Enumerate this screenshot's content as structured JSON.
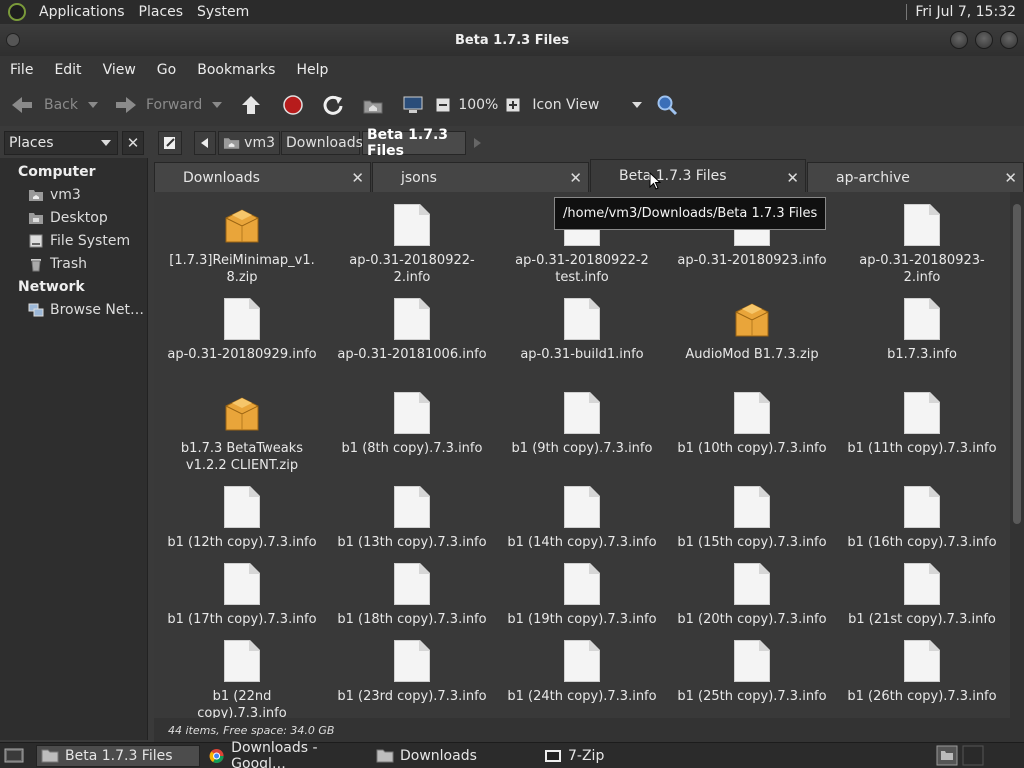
{
  "top_panel": {
    "menus": [
      "Applications",
      "Places",
      "System"
    ],
    "clock": "Fri Jul  7, 15:32"
  },
  "window": {
    "title": "Beta 1.7.3 Files"
  },
  "menubar": [
    "File",
    "Edit",
    "View",
    "Go",
    "Bookmarks",
    "Help"
  ],
  "toolbar": {
    "back": "Back",
    "forward": "Forward",
    "zoom": "100%",
    "view_mode": "Icon View"
  },
  "location": {
    "places_label": "Places",
    "close_glyph": "✕",
    "crumbs": [
      "vm3",
      "Downloads",
      "Beta 1.7.3 Files"
    ]
  },
  "sidebar": {
    "computer_label": "Computer",
    "computer_items": [
      "vm3",
      "Desktop",
      "File System",
      "Trash"
    ],
    "network_label": "Network",
    "network_items": [
      "Browse Net…"
    ]
  },
  "tabs": [
    "Downloads",
    "jsons",
    "Beta 1.7.3 Files",
    "ap-archive"
  ],
  "tab_close_glyph": "✕",
  "tooltip": "/home/vm3/Downloads/Beta 1.7.3 Files",
  "files": [
    {
      "name": "[1.7.3]ReiMinimap_v1.8.zip",
      "kind": "zip"
    },
    {
      "name": "ap-0.31-20180922-2.info",
      "kind": "doc"
    },
    {
      "name": "ap-0.31-20180922-2 test.info",
      "kind": "doc"
    },
    {
      "name": "ap-0.31-20180923.info",
      "kind": "doc"
    },
    {
      "name": "ap-0.31-20180923-2.info",
      "kind": "doc"
    },
    {
      "name": "ap-0.31-20180929.info",
      "kind": "doc"
    },
    {
      "name": "ap-0.31-20181006.info",
      "kind": "doc"
    },
    {
      "name": "ap-0.31-build1.info",
      "kind": "doc"
    },
    {
      "name": "AudioMod B1.7.3.zip",
      "kind": "zip"
    },
    {
      "name": "b1.7.3.info",
      "kind": "doc"
    },
    {
      "name": "b1.7.3 BetaTweaks v1.2.2 CLIENT.zip",
      "kind": "zip"
    },
    {
      "name": "b1 (8th copy).7.3.info",
      "kind": "doc"
    },
    {
      "name": "b1 (9th copy).7.3.info",
      "kind": "doc"
    },
    {
      "name": "b1 (10th copy).7.3.info",
      "kind": "doc"
    },
    {
      "name": "b1 (11th copy).7.3.info",
      "kind": "doc"
    },
    {
      "name": "b1 (12th copy).7.3.info",
      "kind": "doc"
    },
    {
      "name": "b1 (13th copy).7.3.info",
      "kind": "doc"
    },
    {
      "name": "b1 (14th copy).7.3.info",
      "kind": "doc"
    },
    {
      "name": "b1 (15th copy).7.3.info",
      "kind": "doc"
    },
    {
      "name": "b1 (16th copy).7.3.info",
      "kind": "doc"
    },
    {
      "name": "b1 (17th copy).7.3.info",
      "kind": "doc"
    },
    {
      "name": "b1 (18th copy).7.3.info",
      "kind": "doc"
    },
    {
      "name": "b1 (19th copy).7.3.info",
      "kind": "doc"
    },
    {
      "name": "b1 (20th copy).7.3.info",
      "kind": "doc"
    },
    {
      "name": "b1 (21st copy).7.3.info",
      "kind": "doc"
    },
    {
      "name": "b1 (22nd copy).7.3.info",
      "kind": "doc"
    },
    {
      "name": "b1 (23rd copy).7.3.info",
      "kind": "doc"
    },
    {
      "name": "b1 (24th copy).7.3.info",
      "kind": "doc"
    },
    {
      "name": "b1 (25th copy).7.3.info",
      "kind": "doc"
    },
    {
      "name": "b1 (26th copy).7.3.info",
      "kind": "doc"
    }
  ],
  "status": "44 items, Free space: 34.0 GB",
  "taskbar": [
    "Beta 1.7.3 Files",
    "Downloads - Googl…",
    "Downloads",
    "7-Zip"
  ]
}
